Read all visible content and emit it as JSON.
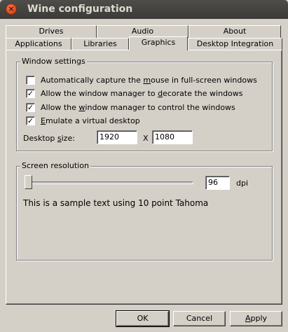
{
  "window": {
    "title": "Wine configuration",
    "close_glyph": "×"
  },
  "tabs": {
    "row1": [
      {
        "label": "Drives"
      },
      {
        "label": "Audio"
      },
      {
        "label": "About"
      }
    ],
    "row2": [
      {
        "label": "Applications"
      },
      {
        "label": "Libraries"
      },
      {
        "label": "Graphics",
        "active": true
      },
      {
        "label": "Desktop Integration"
      }
    ]
  },
  "window_settings": {
    "title": "Window settings",
    "options": [
      {
        "label_pre": "Automatically capture the ",
        "label_u": "m",
        "label_post": "ouse in full-screen windows",
        "checked": false
      },
      {
        "label_pre": "Allow the window manager to ",
        "label_u": "d",
        "label_post": "ecorate the windows",
        "checked": true
      },
      {
        "label_pre": "Allow the ",
        "label_u": "w",
        "label_post": "indow manager to control the windows",
        "checked": true
      },
      {
        "label_pre": "",
        "label_u": "E",
        "label_post": "mulate a virtual desktop",
        "checked": true
      }
    ],
    "desktop_size_label_pre": "Desktop ",
    "desktop_size_label_u": "s",
    "desktop_size_label_post": "ize:",
    "width": "1920",
    "separator": "X",
    "height": "1080"
  },
  "screen_resolution": {
    "title": "Screen resolution",
    "slider_level": 0,
    "dpi_value": "96",
    "dpi_unit": "dpi",
    "sample_text": "This is a sample text using 10 point Tahoma"
  },
  "buttons": {
    "ok": "OK",
    "cancel": "Cancel",
    "apply": "Apply",
    "apply_u": "A",
    "apply_rest": "pply"
  },
  "colors": {
    "titlebar": "#3c3b37",
    "close": "#dd4814",
    "dialog": "#d4d0c8"
  }
}
